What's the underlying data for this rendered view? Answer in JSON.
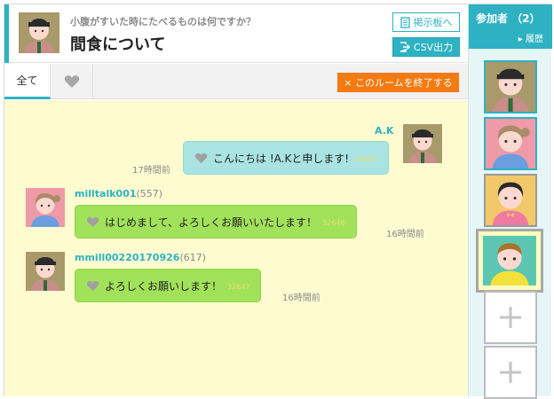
{
  "header": {
    "question": "小腹がすいた時にたべるものは何ですか？",
    "title": "間食について",
    "board_button": "掲示板へ",
    "csv_button": "CSV出力"
  },
  "tabs": {
    "all_label": "全て",
    "end_room_button": "× このルームを終了する"
  },
  "messages": [
    {
      "user": "A.K",
      "user_num": "",
      "text": "こんにちは !A.Kと申します!",
      "msg_id": "32645",
      "time": "17時間前"
    },
    {
      "user": "milltalk001",
      "user_num": "(557)",
      "text": "はじめまして、よろしくお願いいたします！",
      "msg_id": "32646",
      "time": "16時間前"
    },
    {
      "user": "mmill00220170926",
      "user_num": "(617)",
      "text": "よろしくお願いします！",
      "msg_id": "32647",
      "time": "16時間前"
    }
  ],
  "sidebar": {
    "title": "参加者 （2）",
    "history_link": "▸ 履歴"
  },
  "colors": {
    "accent": "#2eb2c3",
    "end_button": "#f47a12",
    "chat_background": "#fffbd0",
    "own_bubble": "#a9e4e2",
    "other_bubble": "#a2e25a"
  }
}
